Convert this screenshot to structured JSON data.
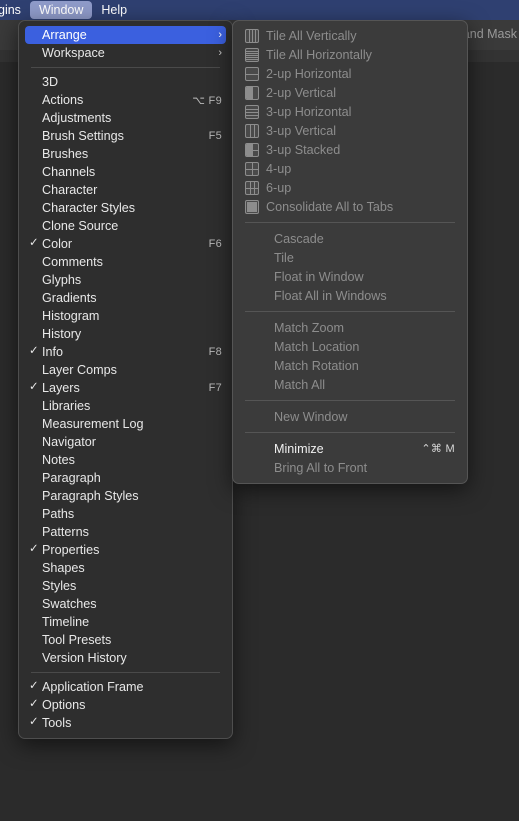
{
  "menubar": {
    "items": [
      {
        "label": "gins",
        "active": false,
        "clipped": true
      },
      {
        "label": "Window",
        "active": true
      },
      {
        "label": "Help",
        "active": false
      }
    ]
  },
  "background": {
    "clipped_label": "t and Mask"
  },
  "window_menu": {
    "groups": [
      {
        "items": [
          {
            "label": "Arrange",
            "checked": false,
            "shortcut": "",
            "submenu": true,
            "highlighted": true
          },
          {
            "label": "Workspace",
            "checked": false,
            "shortcut": "",
            "submenu": true,
            "highlighted": false
          }
        ]
      },
      {
        "items": [
          {
            "label": "3D",
            "checked": false,
            "shortcut": ""
          },
          {
            "label": "Actions",
            "checked": false,
            "shortcut": "⌥ F9"
          },
          {
            "label": "Adjustments",
            "checked": false,
            "shortcut": ""
          },
          {
            "label": "Brush Settings",
            "checked": false,
            "shortcut": "F5"
          },
          {
            "label": "Brushes",
            "checked": false,
            "shortcut": ""
          },
          {
            "label": "Channels",
            "checked": false,
            "shortcut": ""
          },
          {
            "label": "Character",
            "checked": false,
            "shortcut": ""
          },
          {
            "label": "Character Styles",
            "checked": false,
            "shortcut": ""
          },
          {
            "label": "Clone Source",
            "checked": false,
            "shortcut": ""
          },
          {
            "label": "Color",
            "checked": true,
            "shortcut": "F6"
          },
          {
            "label": "Comments",
            "checked": false,
            "shortcut": ""
          },
          {
            "label": "Glyphs",
            "checked": false,
            "shortcut": ""
          },
          {
            "label": "Gradients",
            "checked": false,
            "shortcut": ""
          },
          {
            "label": "Histogram",
            "checked": false,
            "shortcut": ""
          },
          {
            "label": "History",
            "checked": false,
            "shortcut": ""
          },
          {
            "label": "Info",
            "checked": true,
            "shortcut": "F8"
          },
          {
            "label": "Layer Comps",
            "checked": false,
            "shortcut": ""
          },
          {
            "label": "Layers",
            "checked": true,
            "shortcut": "F7"
          },
          {
            "label": "Libraries",
            "checked": false,
            "shortcut": ""
          },
          {
            "label": "Measurement Log",
            "checked": false,
            "shortcut": ""
          },
          {
            "label": "Navigator",
            "checked": false,
            "shortcut": ""
          },
          {
            "label": "Notes",
            "checked": false,
            "shortcut": ""
          },
          {
            "label": "Paragraph",
            "checked": false,
            "shortcut": ""
          },
          {
            "label": "Paragraph Styles",
            "checked": false,
            "shortcut": ""
          },
          {
            "label": "Paths",
            "checked": false,
            "shortcut": ""
          },
          {
            "label": "Patterns",
            "checked": false,
            "shortcut": ""
          },
          {
            "label": "Properties",
            "checked": true,
            "shortcut": ""
          },
          {
            "label": "Shapes",
            "checked": false,
            "shortcut": ""
          },
          {
            "label": "Styles",
            "checked": false,
            "shortcut": ""
          },
          {
            "label": "Swatches",
            "checked": false,
            "shortcut": ""
          },
          {
            "label": "Timeline",
            "checked": false,
            "shortcut": ""
          },
          {
            "label": "Tool Presets",
            "checked": false,
            "shortcut": ""
          },
          {
            "label": "Version History",
            "checked": false,
            "shortcut": ""
          }
        ]
      },
      {
        "items": [
          {
            "label": "Application Frame",
            "checked": true,
            "shortcut": ""
          },
          {
            "label": "Options",
            "checked": true,
            "shortcut": ""
          },
          {
            "label": "Tools",
            "checked": true,
            "shortcut": ""
          }
        ]
      }
    ]
  },
  "arrange_submenu": {
    "groups": [
      {
        "items": [
          {
            "label": "Tile All Vertically",
            "icon": "tile-all-vertically-icon",
            "enabled": false,
            "shortcut": ""
          },
          {
            "label": "Tile All Horizontally",
            "icon": "tile-all-horizontally-icon",
            "enabled": false,
            "shortcut": ""
          },
          {
            "label": "2-up Horizontal",
            "icon": "two-up-horizontal-icon",
            "enabled": false,
            "shortcut": ""
          },
          {
            "label": "2-up Vertical",
            "icon": "two-up-vertical-icon",
            "enabled": false,
            "shortcut": ""
          },
          {
            "label": "3-up Horizontal",
            "icon": "three-up-horizontal-icon",
            "enabled": false,
            "shortcut": ""
          },
          {
            "label": "3-up Vertical",
            "icon": "three-up-vertical-icon",
            "enabled": false,
            "shortcut": ""
          },
          {
            "label": "3-up Stacked",
            "icon": "three-up-stacked-icon",
            "enabled": false,
            "shortcut": ""
          },
          {
            "label": "4-up",
            "icon": "four-up-icon",
            "enabled": false,
            "shortcut": ""
          },
          {
            "label": "6-up",
            "icon": "six-up-icon",
            "enabled": false,
            "shortcut": ""
          },
          {
            "label": "Consolidate All to Tabs",
            "icon": "consolidate-to-tabs-icon",
            "enabled": false,
            "shortcut": ""
          }
        ]
      },
      {
        "items": [
          {
            "label": "Cascade",
            "icon": "",
            "enabled": false,
            "shortcut": ""
          },
          {
            "label": "Tile",
            "icon": "",
            "enabled": false,
            "shortcut": ""
          },
          {
            "label": "Float in Window",
            "icon": "",
            "enabled": false,
            "shortcut": ""
          },
          {
            "label": "Float All in Windows",
            "icon": "",
            "enabled": false,
            "shortcut": ""
          }
        ]
      },
      {
        "items": [
          {
            "label": "Match Zoom",
            "icon": "",
            "enabled": false,
            "shortcut": ""
          },
          {
            "label": "Match Location",
            "icon": "",
            "enabled": false,
            "shortcut": ""
          },
          {
            "label": "Match Rotation",
            "icon": "",
            "enabled": false,
            "shortcut": ""
          },
          {
            "label": "Match All",
            "icon": "",
            "enabled": false,
            "shortcut": ""
          }
        ]
      },
      {
        "items": [
          {
            "label": "New Window",
            "icon": "",
            "enabled": false,
            "shortcut": ""
          }
        ]
      },
      {
        "items": [
          {
            "label": "Minimize",
            "icon": "",
            "enabled": true,
            "shortcut": "⌃⌘ M"
          },
          {
            "label": "Bring All to Front",
            "icon": "",
            "enabled": false,
            "shortcut": ""
          }
        ]
      }
    ]
  },
  "colors": {
    "menubar_bg": "#2f4071",
    "menubar_active": "#8f9bc9",
    "highlight_blue": "#3b60df",
    "menu_bg": "#2e2e2e",
    "submenu_bg": "#3b3b3b",
    "desktop_bg": "#2b2b2b"
  }
}
